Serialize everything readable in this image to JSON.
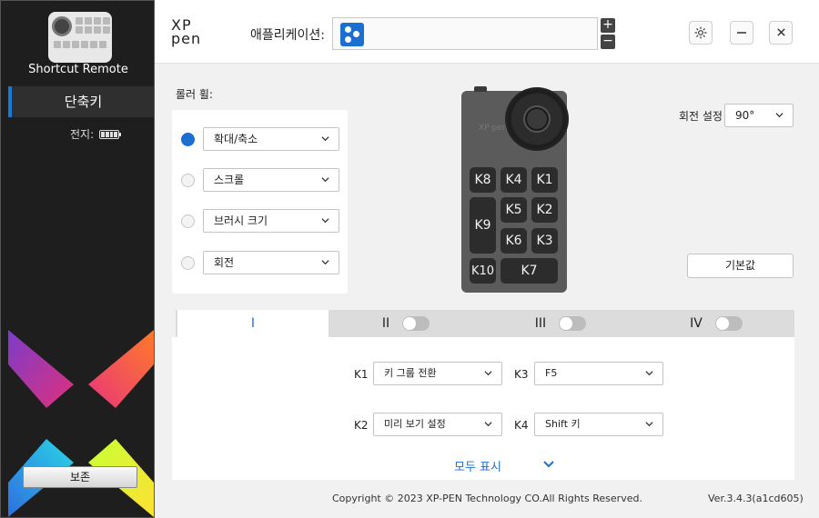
{
  "sidebar": {
    "device_name": "Shortcut Remote",
    "nav_item": "단축키",
    "battery_label": "전지:",
    "save_button": "보존"
  },
  "header": {
    "logo_line1": "XP",
    "logo_line2": "pen",
    "application_label": "애플리케이션:",
    "plus": "+",
    "minus": "−"
  },
  "roller": {
    "label": "롤러 휠:",
    "options": [
      {
        "label": "확대/축소",
        "selected": true
      },
      {
        "label": "스크롤",
        "selected": false
      },
      {
        "label": "브러시 크기",
        "selected": false
      },
      {
        "label": "회전",
        "selected": false
      }
    ]
  },
  "rotation": {
    "label": "회전 설정",
    "value": "90°"
  },
  "default_button": "기본값",
  "device_keys": {
    "k1": "K1",
    "k2": "K2",
    "k3": "K3",
    "k4": "K4",
    "k5": "K5",
    "k6": "K6",
    "k7": "K7",
    "k8": "K8",
    "k9": "K9",
    "k10": "K10",
    "brand": "XP pen"
  },
  "tabs": [
    {
      "label": "I",
      "active": true
    },
    {
      "label": "II",
      "active": false
    },
    {
      "label": "III",
      "active": false
    },
    {
      "label": "IV",
      "active": false
    }
  ],
  "key_mappings": [
    {
      "key": "K1",
      "value": "키 그룹 전환"
    },
    {
      "key": "K3",
      "value": "F5"
    },
    {
      "key": "K2",
      "value": "미리 보기 설정"
    },
    {
      "key": "K4",
      "value": "Shift 키"
    }
  ],
  "show_all": "모두 표시",
  "footer": {
    "copyright": "Copyright © 2023  XP-PEN Technology CO.All Rights Reserved.",
    "version": "Ver.3.4.3(a1cd605)"
  },
  "colors": {
    "accent": "#1a6fd1",
    "sidebar_bg": "#1e1e1e",
    "tab_bar": "#dcdcdc"
  }
}
